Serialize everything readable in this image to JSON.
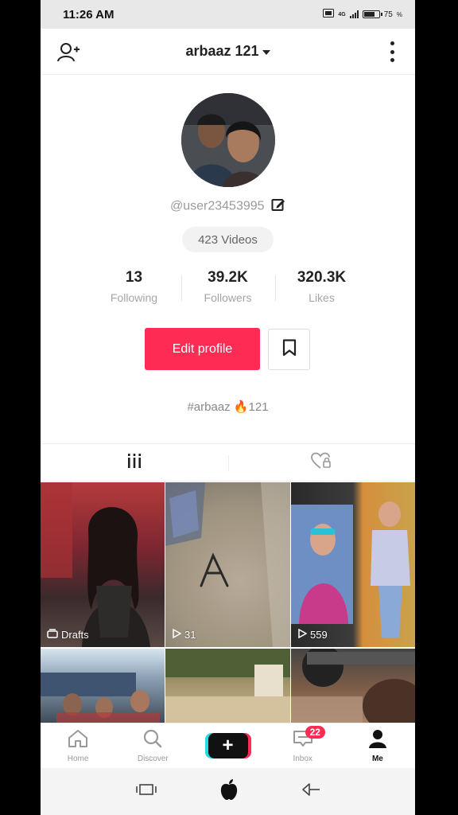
{
  "status_bar": {
    "time": "11:26 AM",
    "battery": "75",
    "battery_level": 0.75,
    "network": "4G"
  },
  "header": {
    "username": "arbaaz 121"
  },
  "profile": {
    "handle": "@user23453995",
    "videos_count": "423 Videos",
    "stats": [
      {
        "value": "13",
        "label": "Following"
      },
      {
        "value": "39.2K",
        "label": "Followers"
      },
      {
        "value": "320.3K",
        "label": "Likes"
      }
    ],
    "edit_button": "Edit profile",
    "bio_prefix": "#arbaaz ",
    "bio_emoji": "🔥",
    "bio_suffix": "121"
  },
  "tabs": [
    {
      "icon": "grid-icon"
    },
    {
      "icon": "liked-heart-icon"
    }
  ],
  "videos": [
    {
      "label": "Drafts",
      "type": "drafts"
    },
    {
      "label": "31",
      "type": "views"
    },
    {
      "label": "559",
      "type": "views"
    },
    {
      "label": "",
      "type": "video"
    },
    {
      "label": "",
      "type": "video"
    },
    {
      "label": "",
      "type": "video"
    }
  ],
  "bottom_nav": [
    {
      "label": "Home",
      "icon": "home-icon"
    },
    {
      "label": "Discover",
      "icon": "search-icon"
    },
    {
      "label": "",
      "icon": "plus-icon"
    },
    {
      "label": "Inbox",
      "icon": "inbox-icon",
      "badge": "22"
    },
    {
      "label": "Me",
      "icon": "profile-icon"
    }
  ],
  "colors": {
    "accent": "#fe2c55",
    "cyan": "#26d9e3"
  }
}
